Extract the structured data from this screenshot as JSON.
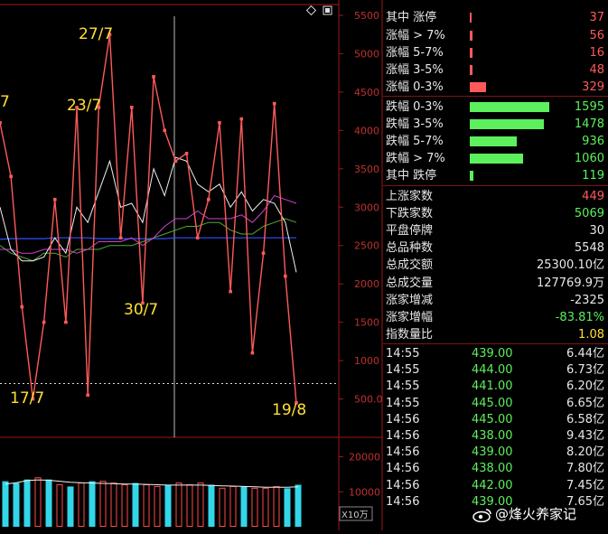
{
  "toolbar": {
    "diamond_icon": "diamond-icon",
    "box_icon": "square-icon"
  },
  "colors": {
    "red": "#ff5a5a",
    "green": "#5cf05c",
    "yellow": "#ffe033",
    "axis": "#a01818"
  },
  "chart_data": [
    {
      "type": "line",
      "y_ticks": [
        "5500",
        "5000",
        "4500",
        "4000",
        "3500",
        "3000",
        "2500",
        "2000",
        "1500",
        "1000",
        "500.0"
      ],
      "ylim": [
        0,
        5700
      ],
      "series": [
        {
          "values": [
            4100,
            3400,
            1700,
            500,
            1500,
            3100,
            1500,
            4300,
            550,
            4300,
            5250,
            2600,
            4300,
            1750,
            4700,
            4000,
            3600,
            3700,
            2600,
            3100,
            4100,
            1900,
            4150,
            1100,
            2400,
            4350,
            2100,
            450
          ]
        },
        {
          "values": [
            2500,
            2400,
            2350,
            2300,
            2400,
            2400,
            2350,
            2450,
            2450,
            2450,
            2500,
            2500,
            2500,
            2550,
            2600,
            2650,
            2700,
            2750,
            2750,
            2800,
            2800,
            2700,
            2650,
            2650,
            2750,
            2800,
            2850,
            2800
          ]
        },
        {
          "values": [
            2450,
            2450,
            2400,
            2400,
            2450,
            2450,
            2450,
            2400,
            2450,
            2550,
            2550,
            2550,
            2600,
            2500,
            2600,
            2750,
            2850,
            2850,
            2950,
            2850,
            2850,
            2850,
            2900,
            2800,
            2950,
            3150,
            3100,
            3050
          ]
        },
        {
          "values": [
            3000,
            2450,
            2300,
            2300,
            2350,
            2600,
            2400,
            3000,
            2800,
            3200,
            3600,
            3000,
            3050,
            2800,
            3500,
            3150,
            3650,
            3600,
            3300,
            3200,
            3300,
            3000,
            3200,
            2950,
            3100,
            3050,
            2800,
            2150
          ]
        },
        {
          "values": [
            2580,
            2590,
            2590,
            2590,
            2590,
            2600,
            2600,
            2600,
            2600,
            2590,
            2590,
            2590,
            2590,
            2590,
            2590,
            2590,
            2600,
            2600,
            2600,
            2600,
            2600,
            2600,
            2600,
            2600,
            2600,
            2600,
            2600,
            2600
          ]
        }
      ],
      "annotations": [
        "7",
        "27/7",
        "23/7",
        "30/7",
        "17/7",
        "19/8"
      ],
      "reference_line": 700
    },
    {
      "type": "bar",
      "y_ticks": [
        "20000",
        "10000"
      ],
      "unit_label": "X10万",
      "ylim": [
        0,
        24000
      ],
      "values": [
        13000,
        12500,
        13500,
        14000,
        13500,
        12000,
        11500,
        12500,
        13000,
        13000,
        12500,
        12000,
        12500,
        12000,
        11500,
        12000,
        12500,
        12000,
        12500,
        12000,
        11000,
        11500,
        11500,
        11000,
        11000,
        11500,
        11000,
        12000
      ],
      "colors": [
        "cyan",
        "cyan",
        "cyan",
        "red",
        "cyan",
        "red",
        "cyan",
        "red",
        "cyan",
        "red",
        "red",
        "red",
        "cyan",
        "red",
        "red",
        "cyan",
        "red",
        "red",
        "red",
        "cyan",
        "red",
        "red",
        "cyan",
        "red",
        "red",
        "red",
        "cyan",
        "cyan"
      ],
      "ma": [
        12200,
        12600,
        13200,
        13400,
        13300,
        13000,
        12700,
        12600,
        12500,
        12400,
        12300,
        12200,
        12200,
        12100,
        12000,
        11900,
        11900,
        11900,
        11900,
        11800,
        11700,
        11600,
        11500,
        11400,
        11300,
        11300,
        11300,
        11400
      ]
    }
  ],
  "stats": [
    {
      "label": "其中 涨停",
      "value": "37",
      "bar_frac": 0.0,
      "color": "red"
    },
    {
      "label": "涨幅 > 7%",
      "value": "56",
      "bar_frac": 0.035,
      "color": "red"
    },
    {
      "label": "涨幅 5-7%",
      "value": "16",
      "bar_frac": 0.01,
      "color": "red"
    },
    {
      "label": "涨幅 3-5%",
      "value": "48",
      "bar_frac": 0.03,
      "color": "red"
    },
    {
      "label": "涨幅 0-3%",
      "value": "329",
      "bar_frac": 0.206,
      "color": "red"
    },
    {
      "label": "跌幅 0-3%",
      "value": "1595",
      "bar_frac": 1.0,
      "color": "green"
    },
    {
      "label": "跌幅 3-5%",
      "value": "1478",
      "bar_frac": 0.927,
      "color": "green"
    },
    {
      "label": "跌幅 5-7%",
      "value": "936",
      "bar_frac": 0.587,
      "color": "green"
    },
    {
      "label": "跌幅 > 7%",
      "value": "1060",
      "bar_frac": 0.665,
      "color": "green"
    },
    {
      "label": "其中 跌停",
      "value": "119",
      "bar_frac": 0.05,
      "color": "green"
    }
  ],
  "summary": [
    {
      "label": "上涨家数",
      "value": "449",
      "color": "red"
    },
    {
      "label": "下跌家数",
      "value": "5069",
      "color": "green"
    },
    {
      "label": "平盘停牌",
      "value": "30",
      "color": "white"
    },
    {
      "label": "总品种数",
      "value": "5548",
      "color": "white"
    },
    {
      "label": "总成交额",
      "value": "25300.10亿",
      "color": "white"
    },
    {
      "label": "总成交量",
      "value": "127769.9万",
      "color": "white"
    },
    {
      "label": "涨家增减",
      "value": "-2325",
      "color": "white"
    },
    {
      "label": "涨家增幅",
      "value": "-83.81%",
      "color": "green"
    },
    {
      "label": "指数量比",
      "value": "1.08",
      "color": "yellow"
    }
  ],
  "ticks": [
    {
      "time": "14:55",
      "price": "439.00",
      "amount": "6.44亿"
    },
    {
      "time": "14:55",
      "price": "444.00",
      "amount": "6.73亿"
    },
    {
      "time": "14:55",
      "price": "441.00",
      "amount": "6.20亿"
    },
    {
      "time": "14:55",
      "price": "445.00",
      "amount": "6.65亿"
    },
    {
      "time": "14:56",
      "price": "445.00",
      "amount": "6.58亿"
    },
    {
      "time": "14:56",
      "price": "438.00",
      "amount": "9.43亿"
    },
    {
      "time": "14:56",
      "price": "439.00",
      "amount": "8.20亿"
    },
    {
      "time": "14:56",
      "price": "438.00",
      "amount": "7.80亿"
    },
    {
      "time": "14:56",
      "price": "442.00",
      "amount": "7.45亿"
    },
    {
      "time": "14:56",
      "price": "439.00",
      "amount": "7.65亿"
    }
  ],
  "watermark": {
    "text": "@烽火养家记"
  }
}
